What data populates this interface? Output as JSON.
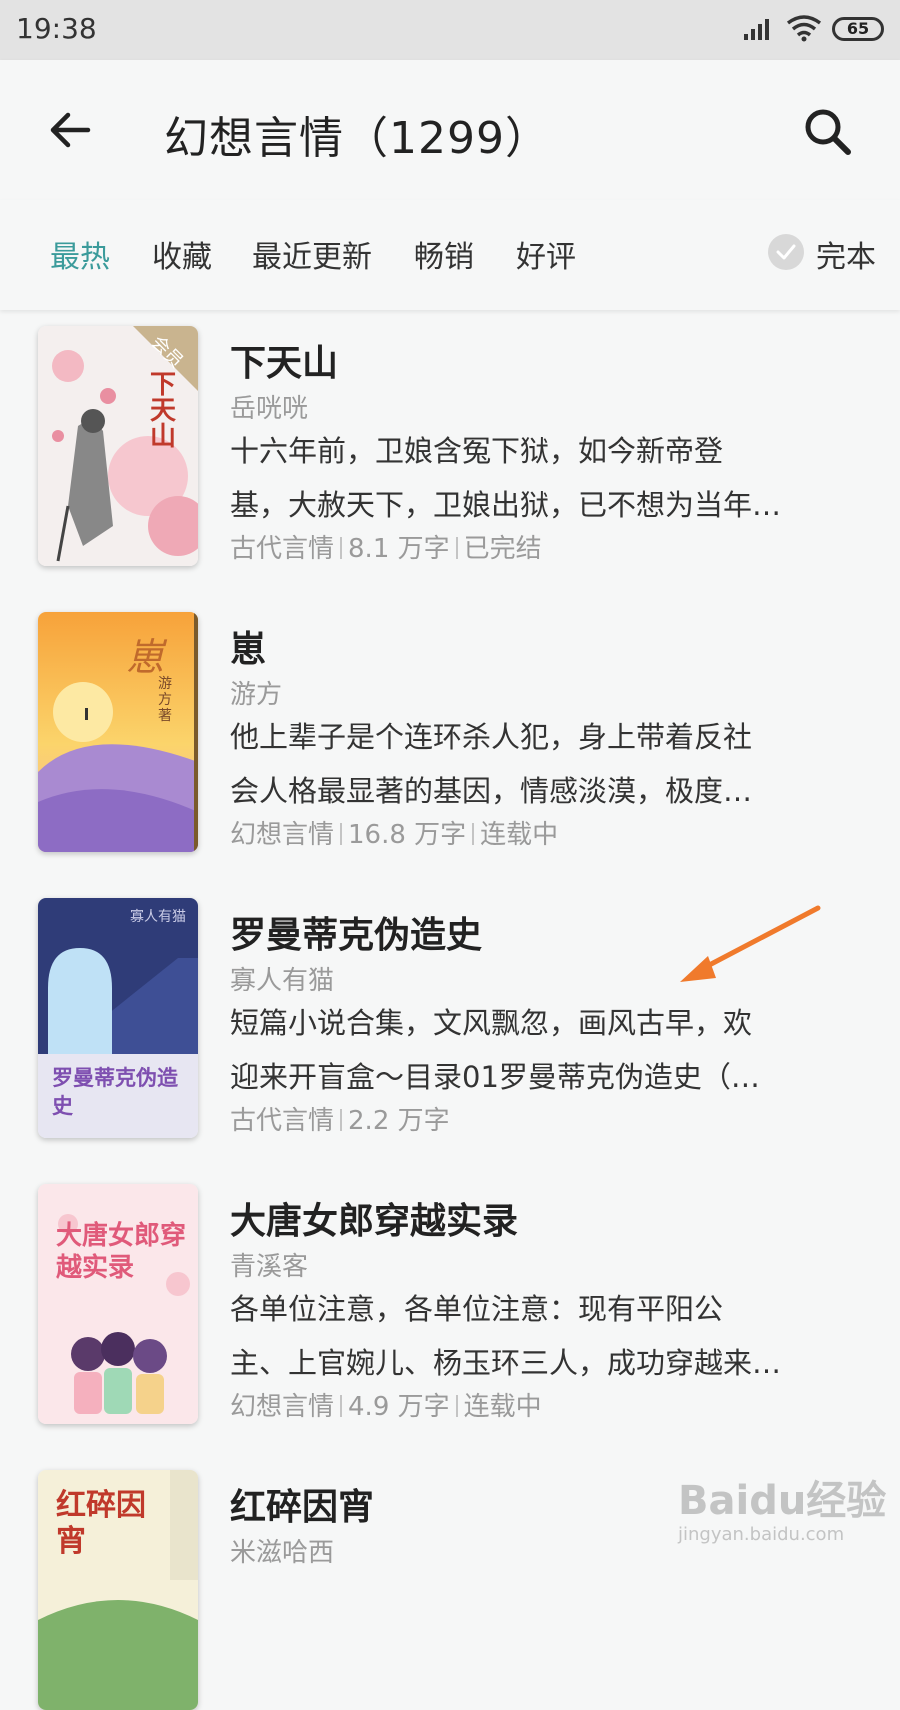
{
  "status_bar": {
    "time": "19:38",
    "battery": "65"
  },
  "header": {
    "title": "幻想言情（1299）"
  },
  "filters": {
    "tabs": [
      "最热",
      "收藏",
      "最近更新",
      "畅销",
      "好评"
    ],
    "active_tab": "最热",
    "complete_label": "完本"
  },
  "books": [
    {
      "title": "下天山",
      "author": "岳咣咣",
      "desc_line1": "十六年前，卫娘含冤下狱，如今新帝登",
      "desc_line2": "基，大赦天下，卫娘出狱，已不想为当年…",
      "category": "古代言情",
      "words": "8.1 万字",
      "status": "已完结",
      "cover_badge": "会员",
      "cover_text": "下天山"
    },
    {
      "title": "崽",
      "author": "游方",
      "desc_line1": "他上辈子是个连环杀人犯，身上带着反社",
      "desc_line2": "会人格最显著的基因，情感淡漠，极度…",
      "category": "幻想言情",
      "words": "16.8 万字",
      "status": "连载中",
      "cover_text": "崽",
      "cover_author": "游方 著"
    },
    {
      "title": "罗曼蒂克伪造史",
      "author": "寡人有猫",
      "desc_line1": "短篇小说合集，文风飘忽，画风古早，欢",
      "desc_line2": "迎来开盲盒～目录01罗曼蒂克伪造史（…",
      "category": "古代言情",
      "words": "2.2 万字",
      "cover_text": "罗曼蒂克伪造史",
      "cover_author": "寡人有猫"
    },
    {
      "title": "大唐女郎穿越实录",
      "author": "青溪客",
      "desc_line1": "各单位注意，各单位注意：现有平阳公",
      "desc_line2": "主、上官婉儿、杨玉环三人，成功穿越来…",
      "category": "幻想言情",
      "words": "4.9 万字",
      "status": "连载中",
      "cover_text": "大唐女郎穿越实录"
    },
    {
      "title": "红碎因宵",
      "author": "米滋哈西",
      "cover_text": "红碎因宵"
    }
  ],
  "watermark": {
    "main": "Baidu经验",
    "sub": "jingyan.baidu.com"
  },
  "colors": {
    "accent": "#3b9b9b",
    "annotation_arrow": "#f07a2c"
  },
  "icons": [
    "signal-icon",
    "wifi-icon",
    "battery-icon",
    "back-arrow-icon",
    "search-icon",
    "check-circle-icon"
  ]
}
